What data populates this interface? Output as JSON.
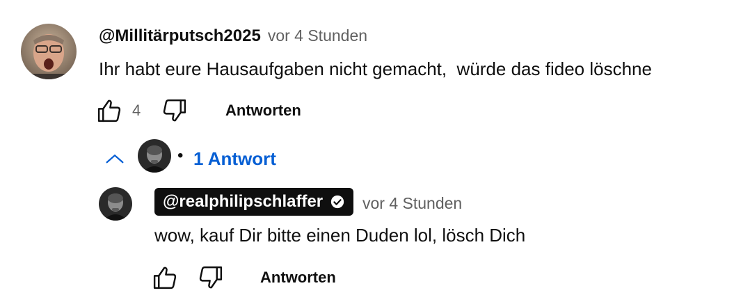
{
  "comment": {
    "author": "@Millitärputsch2025",
    "time": "vor 4 Stunden",
    "text": "Ihr habt eure Hausaufgaben nicht gemacht,  würde das fideo löschne",
    "like_count": "4",
    "reply_label": "Antworten",
    "avatar_icon": "user-avatar"
  },
  "replies_toggle": {
    "label": "1 Antwort",
    "separator": "•",
    "icon": "chevron-up-icon",
    "accent": "#065fd4"
  },
  "reply": {
    "author": "@realphilipschlaffer",
    "verified_icon": "verified-check-icon",
    "time": "vor 4 Stunden",
    "text": "wow, kauf Dir bitte einen Duden lol, lösch Dich",
    "reply_label": "Antworten",
    "avatar_icon": "channel-owner-avatar"
  },
  "colors": {
    "text": "#0f0f0f",
    "muted": "#606060",
    "link": "#065fd4",
    "owner_badge_bg": "#0f0f0f"
  }
}
